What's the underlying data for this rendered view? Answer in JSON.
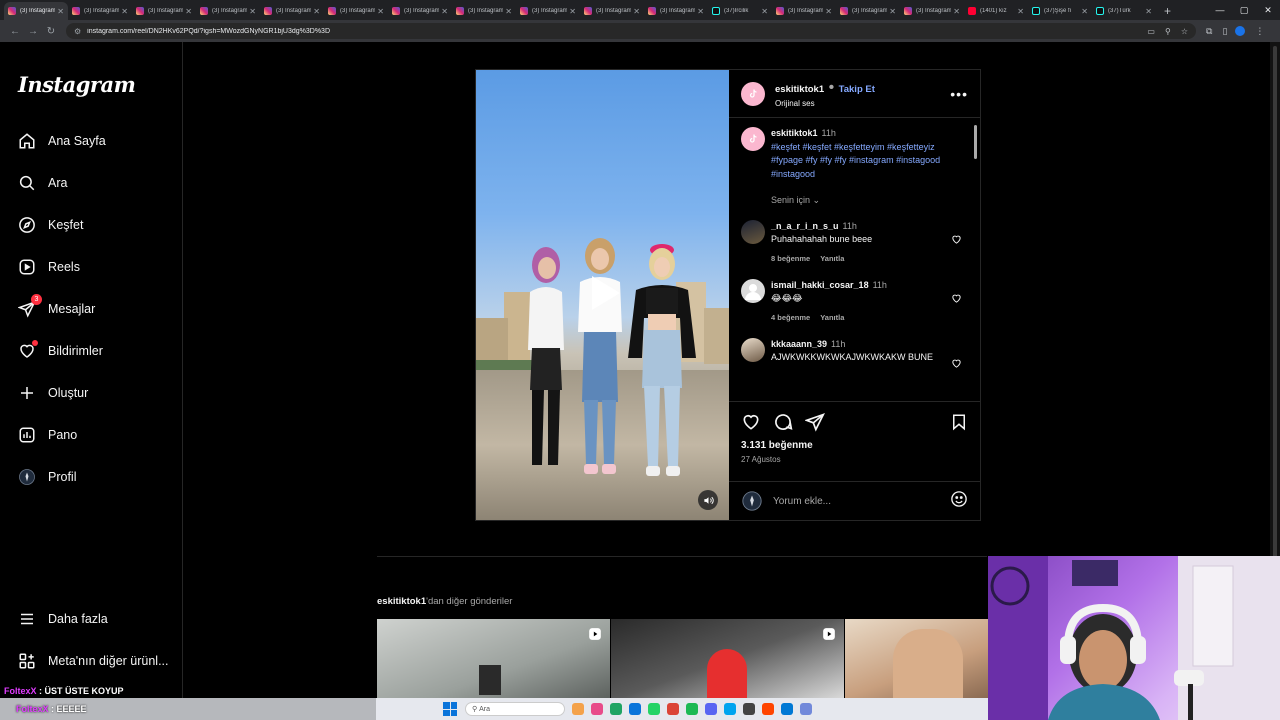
{
  "browser": {
    "tabs": [
      {
        "title": "(3) Instagram",
        "kind": "ig",
        "active": true
      },
      {
        "title": "(3) Instagram",
        "kind": "ig"
      },
      {
        "title": "(3) Instagram",
        "kind": "ig"
      },
      {
        "title": "(3) Instagram",
        "kind": "ig"
      },
      {
        "title": "(3) Instagram",
        "kind": "ig"
      },
      {
        "title": "(3) Instagram",
        "kind": "ig"
      },
      {
        "title": "(3) Instagram",
        "kind": "ig"
      },
      {
        "title": "(3) Instagram",
        "kind": "ig"
      },
      {
        "title": "(3) Instagram",
        "kind": "ig"
      },
      {
        "title": "(3) Instagram",
        "kind": "ig"
      },
      {
        "title": "(3) Instagram",
        "kind": "ig"
      },
      {
        "title": "(37)Ircilik",
        "kind": "tt"
      },
      {
        "title": "(3) Instagram",
        "kind": "ig"
      },
      {
        "title": "(3) Instagram",
        "kind": "ig"
      },
      {
        "title": "(3) Instagram",
        "kind": "ig"
      },
      {
        "title": "(1401) kız",
        "kind": "yt"
      },
      {
        "title": "(37)Şişe fı",
        "kind": "tt"
      },
      {
        "title": "(37)Türk",
        "kind": "tt"
      }
    ],
    "url": "instagram.com/reel/DN2HKv62PQd/?igsh=MWozdGNyNGR1bjU3dg%3D%3D",
    "newtab_label": "+",
    "win_min": "—",
    "win_max": "▢",
    "win_close": "✕"
  },
  "sidebar": {
    "logo": "Instagram",
    "items": [
      {
        "label": "Ana Sayfa",
        "icon": "home-icon"
      },
      {
        "label": "Ara",
        "icon": "search-icon"
      },
      {
        "label": "Keşfet",
        "icon": "explore-icon"
      },
      {
        "label": "Reels",
        "icon": "reels-icon"
      },
      {
        "label": "Mesajlar",
        "icon": "messenger-icon",
        "badge": "3"
      },
      {
        "label": "Bildirimler",
        "icon": "heart-icon",
        "dot": true
      },
      {
        "label": "Oluştur",
        "icon": "plus-icon"
      },
      {
        "label": "Pano",
        "icon": "dashboard-icon"
      },
      {
        "label": "Profil",
        "icon": "profile-avatar"
      }
    ],
    "more": "Daha fazla",
    "meta": "Meta'nın diğer ürünl..."
  },
  "post": {
    "author": "eskitiktok1",
    "separator": "•",
    "follow": "Takip Et",
    "audio": "Orijinal ses",
    "caption_time": "11h",
    "caption_tags": "#keşfet #keşfet #keşfetteyim #keşfetteyiz #fypage #fy #fy #fy #instagram #instagood #instagood",
    "sort_label": "Senin için",
    "comments": [
      {
        "user": "_n_a_r_i_n_s_u",
        "time": "11h",
        "text": "Puhahahahah bune beee",
        "likes": "8 beğenme",
        "reply": "Yanıtla",
        "avatar_color": "#3b3426"
      },
      {
        "user": "ismail_hakki_cosar_18",
        "time": "11h",
        "text": "😂😂😂",
        "likes": "4 beğenme",
        "reply": "Yanıtla",
        "avatar_color": "#dbdbdb"
      },
      {
        "user": "kkkaaann_39",
        "time": "11h",
        "text": "AJWKWKKWKWKAJWKWKAKW BUNE",
        "likes": "",
        "reply": "",
        "avatar_color": "#6e5a46"
      }
    ],
    "like_count": "3.131 beğenme",
    "date": "27 Ağustos",
    "add_comment_placeholder": "Yorum ekle..."
  },
  "more_posts": {
    "author": "eskitiktok1",
    "suffix": "'dan diğer gönderiler"
  },
  "stream_overlay": {
    "line1_name": "FoltexX",
    "line1_text": ": ÜST ÜSTE KOYUP",
    "line2_name": "FoltexX",
    "line2_text": ": EEEEE"
  },
  "taskbar": {
    "search_placeholder": "Ara",
    "apps": [
      "#f4a24a",
      "#e84b8a",
      "#1fa463",
      "#0a74da",
      "#25d366",
      "#db4437",
      "#1db954",
      "#5865f2",
      "#00a4ef",
      "#444444",
      "#ff4500",
      "#0078d4",
      "#7289da"
    ]
  },
  "colors": {
    "accent_link": "#85a9ff",
    "notification_red": "#ff3040",
    "overlay_name": "#e03cff"
  }
}
